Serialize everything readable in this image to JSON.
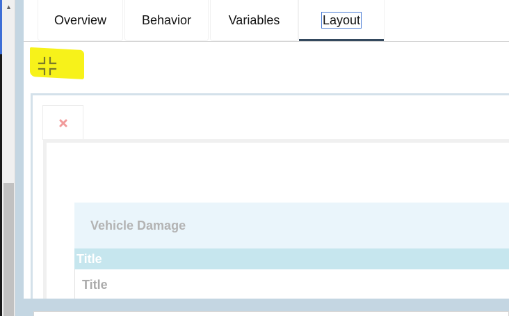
{
  "tabs": [
    {
      "label": "Overview"
    },
    {
      "label": "Behavior"
    },
    {
      "label": "Variables"
    },
    {
      "label": "Layout"
    }
  ],
  "active_tab": "Layout",
  "layout": {
    "section_title": "Vehicle Damage",
    "header_row_label": "Title",
    "field_label": "Title"
  },
  "icons": {
    "collapse": "collapse-icon",
    "remove": "close-icon",
    "scroll_up": "arrow-up-icon"
  },
  "colors": {
    "highlight": "#f7f21a",
    "active_tab_underline": "#34495e",
    "remove_icon": "#f19a9a",
    "section_header_bg": "#eaf5fb",
    "title_row_bg": "#c6e6ee"
  }
}
